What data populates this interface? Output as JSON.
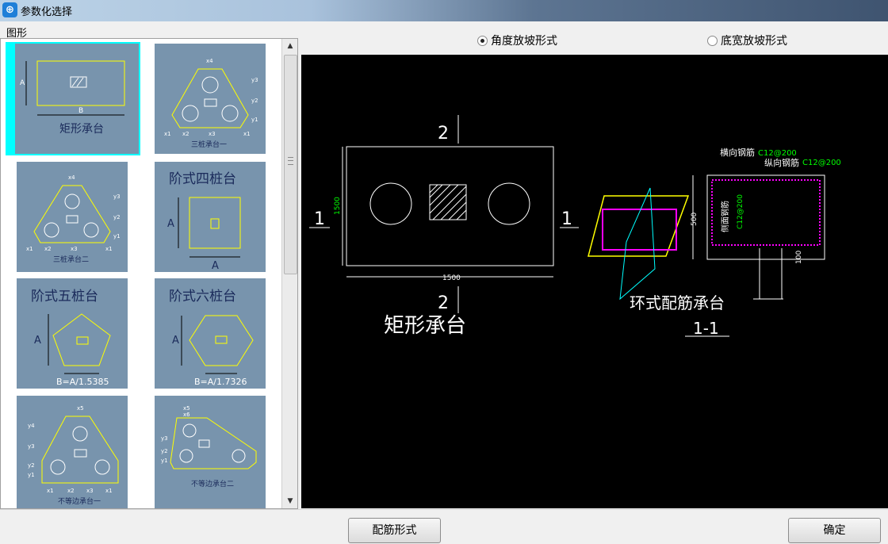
{
  "window": {
    "title": "参数化选择"
  },
  "left": {
    "group_label": "图形",
    "thumbnails": [
      {
        "name": "矩形承台",
        "dim_a": "A",
        "dim_b": "B"
      },
      {
        "name": "三桩承台一",
        "dims": [
          "x4",
          "y3",
          "y2",
          "y1",
          "x1",
          "x2",
          "x3",
          "x1"
        ]
      },
      {
        "name": "三桩承台二",
        "dims": [
          "x4",
          "y3",
          "y2",
          "y1",
          "x1",
          "x2",
          "x3",
          "x1"
        ]
      },
      {
        "name": "阶式四桩台",
        "dim_a": "A",
        "dim_b": "A"
      },
      {
        "name": "阶式五桩台",
        "dim_a": "A",
        "formula": "B=A/1.5385"
      },
      {
        "name": "阶式六桩台",
        "dim_a": "A",
        "formula": "B=A/1.7326"
      },
      {
        "name": "不等边承台一",
        "dims": [
          "x5",
          "y4",
          "y3",
          "y2",
          "y1",
          "x1",
          "x2",
          "x3",
          "x1"
        ]
      },
      {
        "name": "不等边承台二",
        "dims": [
          "x5",
          "x6",
          "y3",
          "y2",
          "y1"
        ]
      }
    ]
  },
  "options": {
    "radio_angle": "角度放坡形式",
    "radio_width": "底宽放坡形式",
    "selected": "角度放坡形式"
  },
  "preview": {
    "section_mark": "2",
    "side_mark": "1",
    "dim_width": "1500",
    "dim_height": "1500",
    "shape_name": "矩形承台",
    "rebar_title": "环式配筋承台",
    "section_label": "1-1",
    "horizontal_bar": "横向钢筋",
    "horizontal_spec": "C12@200",
    "vertical_bar": "纵向钢筋",
    "vertical_spec": "C12@200",
    "side_bar": "侧面钢筋",
    "side_spec": "C12@200",
    "dim_section_height": "500",
    "dim_bottom": "100"
  },
  "buttons": {
    "rebar_form": "配筋形式",
    "ok": "确定"
  },
  "colors": {
    "selected_bg": "#00ffff",
    "thumb_bg": "#7894ad",
    "preview_bg": "#000000",
    "cad_yellow": "#ffff00",
    "cad_magenta": "#ff00ff",
    "cad_green": "#00ff00",
    "cad_cyan": "#00ffff"
  }
}
